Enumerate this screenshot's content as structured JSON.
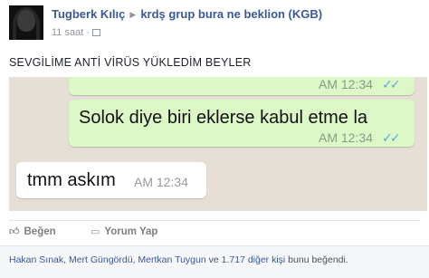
{
  "post": {
    "author": "Tugberk Kılıç",
    "group": "krdş grup bura ne beklion (KGB)",
    "timestamp": "11 saat",
    "audience_icon": "friends-icon",
    "text": "SEVGİLİME ANTİ VİRÜS YÜKLEDİM BEYLER"
  },
  "chat": {
    "top_partial_time": "AM 12:34",
    "outgoing": {
      "text": "Solok diye biri eklerse kabul etme la",
      "time": "AM 12:34"
    },
    "incoming": {
      "text": "tmm askım",
      "time": "AM 12:34"
    },
    "tick_icon": "double-check-icon",
    "colors": {
      "background": "#e6dfd6",
      "outgoing_bubble": "#dcf8c6",
      "incoming_bubble": "#ffffff",
      "read_ticks": "#5aa6e6"
    }
  },
  "actions": {
    "like_label": "Beğen",
    "comment_label": "Yorum Yap"
  },
  "likes": {
    "names": "Hakan Sınak, Mert Güngördü, Mertkan Tuygun",
    "joiner": " ve ",
    "others": "1.717 diğer kişi",
    "suffix": " bunu beğendi."
  }
}
